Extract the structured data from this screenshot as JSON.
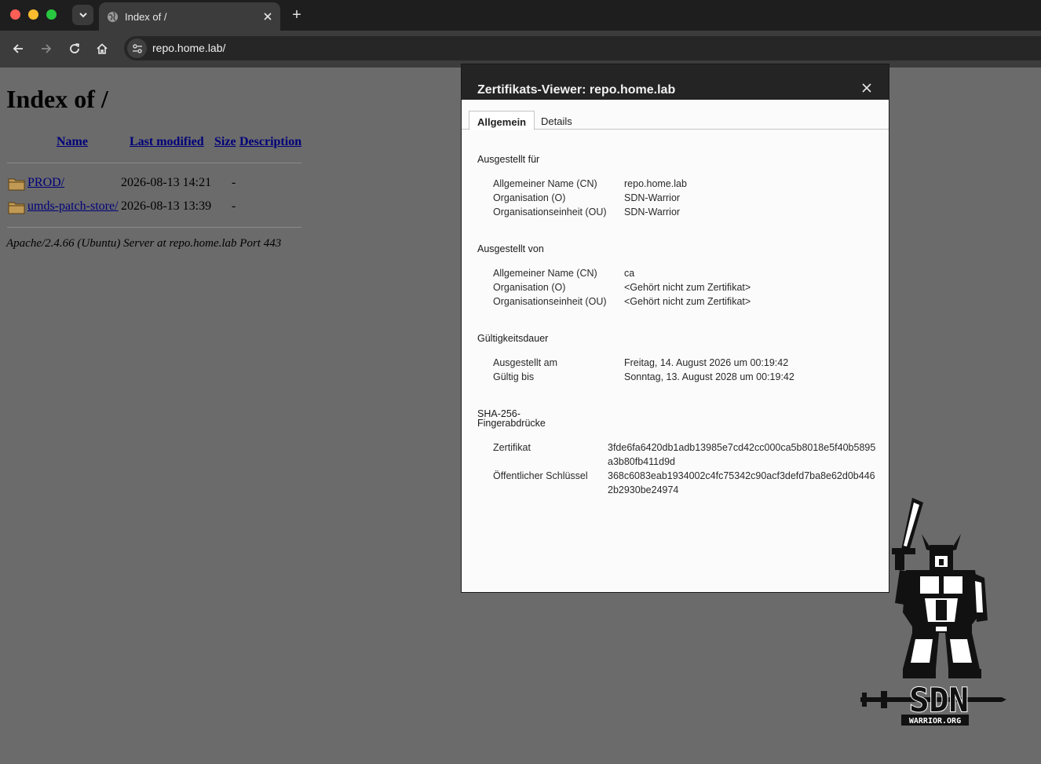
{
  "browser": {
    "tab_title": "Index of /",
    "new_tab_label": "+",
    "url": "repo.home.lab/"
  },
  "page": {
    "heading": "Index of /",
    "columns": {
      "name": "Name",
      "last_modified": "Last modified",
      "size": "Size",
      "description": "Description"
    },
    "entries": [
      {
        "name": "PROD/",
        "modified": "2026-08-13 14:21",
        "size": "-"
      },
      {
        "name": "umds-patch-store/",
        "modified": "2026-08-13 13:39",
        "size": "-"
      }
    ],
    "address": "Apache/2.4.66 (Ubuntu) Server at repo.home.lab Port 443"
  },
  "dialog": {
    "title": "Zertifikats-Viewer: repo.home.lab",
    "tabs": [
      "Allgemein",
      "Details"
    ],
    "issued_to": {
      "heading": "Ausgestellt für",
      "rows": [
        {
          "label": "Allgemeiner Name (CN)",
          "value": "repo.home.lab"
        },
        {
          "label": "Organisation (O)",
          "value": "SDN-Warrior"
        },
        {
          "label": "Organisationseinheit (OU)",
          "value": "SDN-Warrior"
        }
      ]
    },
    "issued_by": {
      "heading": "Ausgestellt von",
      "rows": [
        {
          "label": "Allgemeiner Name (CN)",
          "value": "ca"
        },
        {
          "label": "Organisation (O)",
          "value": "<Gehört nicht zum Zertifikat>"
        },
        {
          "label": "Organisationseinheit (OU)",
          "value": "<Gehört nicht zum Zertifikat>"
        }
      ]
    },
    "validity": {
      "heading": "Gültigkeitsdauer",
      "rows": [
        {
          "label": "Ausgestellt am",
          "value": "Freitag, 14. August 2026 um 00:19:42"
        },
        {
          "label": "Gültig bis",
          "value": "Sonntag, 13. August 2028 um 00:19:42"
        }
      ]
    },
    "fingerprints": {
      "heading_line1": "SHA-256-",
      "heading_line2": "Fingerabdrücke",
      "rows": [
        {
          "label": "Zertifikat",
          "value": "3fde6fa6420db1adb13985e7cd42cc000ca5b8018e5f40b5895a3b80fb411d9d"
        },
        {
          "label": "Öffentlicher Schlüssel",
          "value": "368c6083eab1934002c4fc75342c90acf3defd7ba8e62d0b4462b2930be24974"
        }
      ]
    }
  },
  "watermark": {
    "brand": "SDN",
    "site": "WARRIOR.ORG"
  }
}
